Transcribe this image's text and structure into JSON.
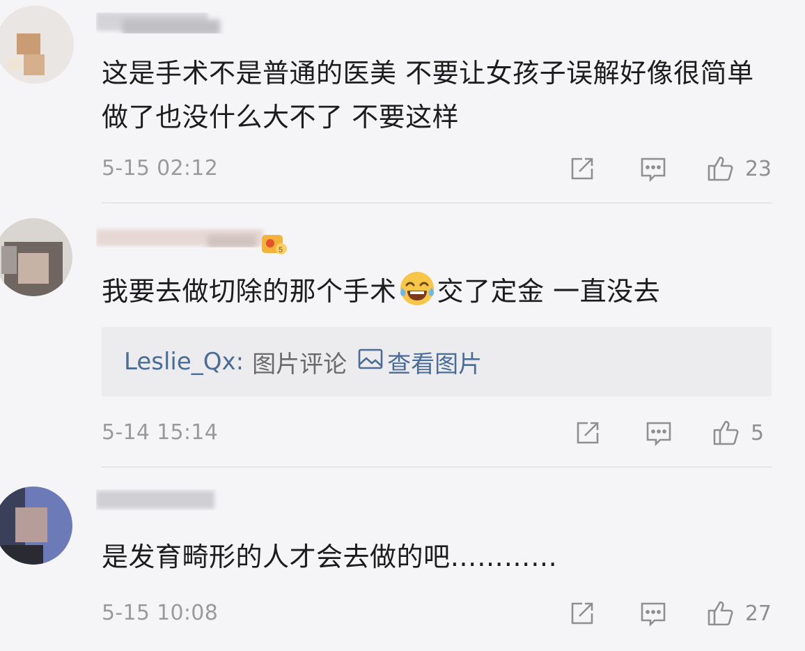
{
  "comments": [
    {
      "text": "这是手术不是普通的医美 不要让女孩子误解好像很简单做了也没什么大不了 不要这样",
      "time": "5-15 02:12",
      "likes": "23",
      "icons": {
        "share": "share-icon",
        "reply": "comment-icon",
        "like": "thumbs-up-icon"
      }
    },
    {
      "text_before": "我要去做切除的那个手术",
      "emoji": "laugh-cry-emoji",
      "text_after": "交了定金 一直没去",
      "quote": {
        "user": "Leslie_Qx:",
        "text": "图片评论",
        "link_icon": "image-icon",
        "link": "查看图片"
      },
      "badge": "vip-badge-icon",
      "time": "5-14 15:14",
      "likes": "5"
    },
    {
      "text": "是发育畸形的人才会去做的吧…………",
      "time": "5-15 10:08",
      "likes": "27"
    }
  ],
  "colors": {
    "background": "#f5f5f7",
    "link": "#4a6d97",
    "meta": "#9a9a9a",
    "quote_bg": "#ececee"
  }
}
